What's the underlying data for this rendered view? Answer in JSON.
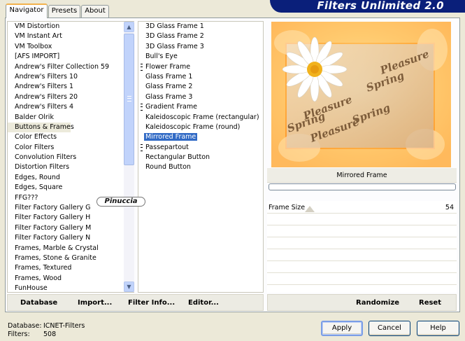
{
  "window": {
    "title": "Filters Unlimited 2.0"
  },
  "tabs": [
    {
      "label": "Navigator",
      "active": true
    },
    {
      "label": "Presets",
      "active": false
    },
    {
      "label": "About",
      "active": false
    }
  ],
  "categories": {
    "selected": "Buttons & Frames",
    "items": [
      "VM Distortion",
      "VM Instant Art",
      "VM Toolbox",
      "[AFS IMPORT]",
      "Andrew's Filter Collection 59",
      "Andrew's Filters 10",
      "Andrew's Filters 1",
      "Andrew's Filters 20",
      "Andrew's Filters 4",
      "Balder Olrik",
      "Buttons & Frames",
      "Color Effects",
      "Color Filters",
      "Convolution Filters",
      "Distortion Filters",
      "Edges, Round",
      "Edges, Square",
      "FFG???",
      "Filter Factory Gallery G",
      "Filter Factory Gallery H",
      "Filter Factory Gallery M",
      "Filter Factory Gallery N",
      "Frames, Marble & Crystal",
      "Frames, Stone & Granite",
      "Frames, Textured",
      "Frames, Wood",
      "FunHouse"
    ]
  },
  "filters": {
    "selected": "Mirrored Frame",
    "items": [
      {
        "label": "3D Glass Frame 1",
        "marked": false
      },
      {
        "label": "3D Glass Frame 2",
        "marked": false
      },
      {
        "label": "3D Glass Frame 3",
        "marked": false
      },
      {
        "label": "Bull's Eye",
        "marked": false
      },
      {
        "label": "Flower Frame",
        "marked": true
      },
      {
        "label": "Glass Frame 1",
        "marked": false
      },
      {
        "label": "Glass Frame 2",
        "marked": false
      },
      {
        "label": "Glass Frame 3",
        "marked": false
      },
      {
        "label": "Gradient Frame",
        "marked": true
      },
      {
        "label": "Kaleidoscopic Frame (rectangular)",
        "marked": false
      },
      {
        "label": "Kaleidoscopic Frame (round)",
        "marked": false
      },
      {
        "label": "Mirrored Frame",
        "marked": false
      },
      {
        "label": "Passepartout",
        "marked": true
      },
      {
        "label": "Rectangular Button",
        "marked": false
      },
      {
        "label": "Round Button",
        "marked": false
      }
    ]
  },
  "preview": {
    "texts": [
      "Pleasure",
      "Spring",
      "Pleasure",
      "Spring",
      "Pleasure",
      "Spring"
    ],
    "colors": {
      "orange": "#ff9f33",
      "light": "#ffd88e",
      "paper": "#e8d2b0"
    }
  },
  "effect": {
    "name": "Mirrored Frame"
  },
  "params": [
    {
      "label": "Frame Size",
      "value": "54",
      "fraction": 0.21
    }
  ],
  "bottom_left": {
    "database": "Database",
    "import": "Import...",
    "filter_info": "Filter Info...",
    "editor": "Editor..."
  },
  "bottom_right": {
    "randomize": "Randomize",
    "reset": "Reset"
  },
  "status": {
    "database_label": "Database:",
    "database_value": "ICNET-Filters",
    "filters_label": "Filters:",
    "filters_value": "508"
  },
  "dialog": {
    "apply": "Apply",
    "cancel": "Cancel",
    "help": "Help"
  },
  "watermark": {
    "text": "Pinuccia"
  },
  "scrollbar": {
    "up_icon": "chevron-up-icon",
    "down_icon": "chevron-down-icon"
  }
}
